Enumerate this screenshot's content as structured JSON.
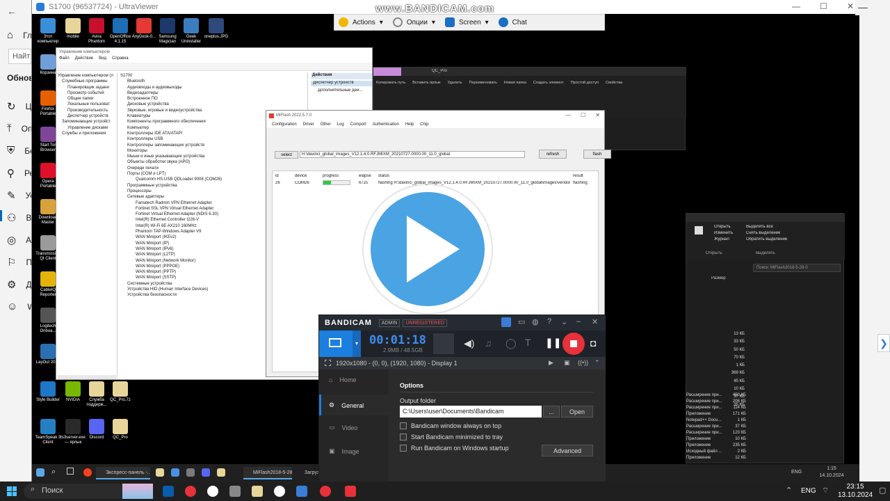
{
  "watermark": "www.BANDICAM.com",
  "host": {
    "items": [
      "Гл",
      "Найти",
      "Обновл",
      "Це",
      "Оп",
      "Без",
      "Ре",
      "Ус",
      "Воз",
      "Ак",
      "Пл",
      "Ди",
      "Wi"
    ]
  },
  "ultraviewer": {
    "title": "S1700 (96537724) - UltraViewer",
    "toolbar": {
      "actions": "Actions",
      "options": "Опции",
      "screen": "Screen",
      "chat": "Chat"
    }
  },
  "desktop_icons": [
    {
      "label": "Этот компьютер",
      "color": "#3a8fd8"
    },
    {
      "label": "mobile",
      "color": "#e8d59a"
    },
    {
      "label": "Avira Phantom",
      "color": "#c8102e"
    },
    {
      "label": "OpenOffice 4.1.15",
      "color": "#1e6eb5"
    },
    {
      "label": "AnyDesk-0...",
      "color": "#e53935"
    },
    {
      "label": "Samsung Magician",
      "color": "#1b3a6b"
    },
    {
      "label": "Geek Uninstaller",
      "color": "#3c7dbf"
    },
    {
      "label": "oneplus.JPG",
      "color": "#2e4a7a"
    },
    {
      "label": "Корзина",
      "color": "#6f9fd8"
    },
    {
      "label": "Firefox Portable",
      "color": "#e66000"
    },
    {
      "label": "Start Tor Browser",
      "color": "#7d4698"
    },
    {
      "label": "Opera Portable",
      "color": "#e0102a"
    },
    {
      "label": "Download Master",
      "color": "#d8a13a"
    },
    {
      "label": "Transmission Qt Client",
      "color": "#9a9a9a"
    },
    {
      "label": "CableIQ Reporter",
      "color": "#e3b30a"
    },
    {
      "label": "Logitech Onboa...",
      "color": "#555555"
    },
    {
      "label": "LayOut 2022",
      "color": "#2b6fb3"
    },
    {
      "label": "Style Builder",
      "color": "#1e78c8"
    },
    {
      "label": "NVIDIA",
      "color": "#76b900"
    },
    {
      "label": "Служба поддерж...",
      "color": "#e8d59a"
    },
    {
      "label": "QC_Pro.7z",
      "color": "#e8d59a"
    },
    {
      "label": "TeamSpeak 3 Client",
      "color": "#2580c3"
    },
    {
      "label": "ts3server.exe — ярлык",
      "color": "#2a2a2a"
    },
    {
      "label": "Discord",
      "color": "#5865f2"
    },
    {
      "label": "QC_Pro",
      "color": "#e8d59a"
    }
  ],
  "mmc": {
    "title": "Управление компьютером",
    "menu": [
      "Файл",
      "Действие",
      "Вид",
      "Справка"
    ],
    "tree": [
      "Управление компьютером (л",
      "Служебные программы",
      "Планировщик задани",
      "Просмотр событий",
      "Общие папки",
      "Локальные пользоват",
      "Производительность",
      "Диспетчер устройств",
      "Запоминающие устройст",
      "Управление дисками",
      "Службы и приложения"
    ],
    "devices": [
      "S1700",
      "Bluetooth",
      "Аудиовходы и аудиовыходы",
      "Видеоадаптеры",
      "Встроенное ПО",
      "Дисковые устройства",
      "Звуковые, игровые и видеоустройства",
      "Клавиатуры",
      "Компоненты программного обеспечения",
      "Компьютер",
      "Контроллеры IDE ATA/ATAPI",
      "Контроллеры USB",
      "Контроллеры запоминающих устройств",
      "Мониторы",
      "Мыши и иные указывающие устройства",
      "Объекты обработки звука (APO)",
      "Очереди печати",
      "Порты (COM и LPT)",
      "Qualcomm HS-USB QDLoader 9008 (COM26)",
      "Программные устройства",
      "Процессоры",
      "Сетевые адаптеры",
      "Famatech Radmin VPN Ethernet Adapter",
      "Fortinet SSL VPN Virtual Ethernet Adapter",
      "Fortinet Virtual Ethernet Adapter (NDIS 6.30)",
      "Intel(R) Ethernet Controller I226-V",
      "Intel(R) Wi-Fi 6E AX210 160MHz",
      "Phantom TAP-Windows Adapter V9",
      "WAN Miniport (IKEv2)",
      "WAN Miniport (IP)",
      "WAN Miniport (IPv6)",
      "WAN Miniport (L2TP)",
      "WAN Miniport (Network Monitor)",
      "WAN Miniport (PPPOE)",
      "WAN Miniport (PPTP)",
      "WAN Miniport (SSTP)",
      "Системные устройства",
      "Устройства HID (Human Interface Devices)",
      "Устройства безопасности"
    ],
    "actions_title": "Действия",
    "actions": [
      "Диспетчер устройств",
      "Дополнительные дей..."
    ]
  },
  "miflash": {
    "title": "MiFlash 2022.5.7.0",
    "menu": [
      "Configuration",
      "Driver",
      "Other",
      "Log",
      "Comport",
      "Authentication",
      "Help",
      "Chip"
    ],
    "select_label": "select",
    "path": "H:\\davinci_global_images_V12.1.4.0.RFJMIXM_20210727.0000.00_11.0_global",
    "refresh_label": "refresh",
    "flash_label": "flash",
    "columns": [
      "id",
      "device",
      "progress",
      "elapse",
      "status",
      "result"
    ],
    "row": {
      "id": "26",
      "device": "COM26",
      "progress": 0.3,
      "elapse": "672s",
      "status": "flashing H:\\davinci_global_images_V12.1.4.0.RFJMIXM_20210727.0000.00_11.0_global\\images\\vendor.img",
      "result": "flashing"
    }
  },
  "explorer": {
    "title": "QC_Pro",
    "ribbon": [
      "Копировать путь",
      "Вставить ярлык",
      "Удалить",
      "Переименовать",
      "Новая папка",
      "Создать элемент",
      "Простой доступ",
      "Свойства",
      "Открыть",
      "Изменить",
      "Журнал",
      "Выделить все",
      "Снять выделение",
      "Обратить выделение"
    ],
    "open_label": "Открыть",
    "select_label": "Выделить",
    "size_header": "Размер",
    "search": "Поиск: MiFlash2018-5-28-0"
  },
  "explorer_rows": [
    {
      "type": "Расширение при...",
      "size": "450 КБ"
    },
    {
      "type": "Расширение при...",
      "size": "206 КБ"
    },
    {
      "type": "Расширение при...",
      "size": "114 КБ"
    },
    {
      "type": "Приложение",
      "size": "171 КБ"
    },
    {
      "type": "Notepad++ Docu...",
      "size": "1 КБ"
    },
    {
      "type": "Расширение при...",
      "size": "37 КБ"
    },
    {
      "type": "Расширение при...",
      "size": "123 КБ"
    },
    {
      "type": "Приложение",
      "size": "10 КБ"
    },
    {
      "type": "Приложение",
      "size": "235 КБ"
    },
    {
      "type": "Исходный файл ...",
      "size": "2 КБ"
    },
    {
      "type": "Приложение",
      "size": "12 КБ"
    }
  ],
  "explorer_sizes": [
    "13 КБ",
    "33 КБ",
    "50 КБ",
    "70 КБ",
    "1 КБ",
    "369 КБ",
    "45 КБ",
    "10 КБ",
    "37 КБ",
    "35 КБ"
  ],
  "bandicam": {
    "brand": "BANDICAM",
    "admin": "ADMIN",
    "unregistered": "UNREGISTERED",
    "timer": "00:01:18",
    "size": "2.9MB / 48.5GB",
    "display": "1920x1080 - (0, 0), (1920, 1080) - Display 1",
    "side": [
      "Home",
      "General",
      "Video",
      "Image"
    ],
    "options_title": "Options",
    "output_label": "Output folder",
    "output_path": "C:\\Users\\user\\Documents\\Bandicam",
    "browse": "...",
    "open": "Open",
    "checks": [
      "Bandicam window always on top",
      "Start Bandicam minimized to tray",
      "Run Bandicam on Windows startup"
    ],
    "advanced": "Advanced"
  },
  "remote_taskbar": {
    "items": [
      "Экспресс-панель -...",
      "MiFlash2018-5-28-0",
      "Загрузки"
    ],
    "lang": "ENG",
    "time": "1:15",
    "date": "14.10.2024"
  },
  "host_taskbar": {
    "search": "Поиск",
    "lang": "ENG",
    "time": "23:15",
    "date": "13.10.2024"
  }
}
